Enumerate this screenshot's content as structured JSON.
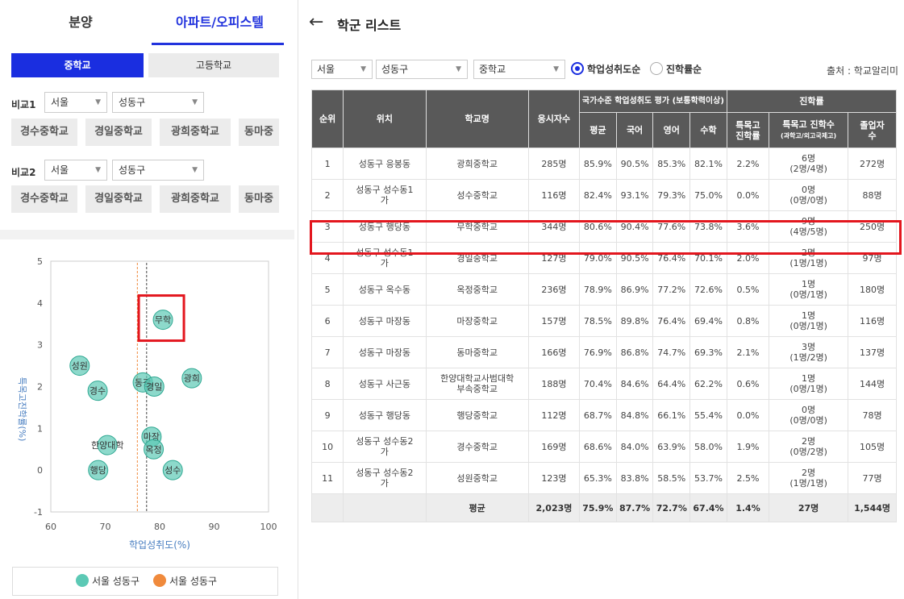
{
  "tabs": {
    "presale": "분양",
    "apt": "아파트/오피스텔"
  },
  "level_buttons": {
    "middle": "중학교",
    "high": "고등학교"
  },
  "compare1": {
    "label": "비교1",
    "city": "서울",
    "district": "성동구",
    "chips": [
      "경수중학교",
      "경일중학교",
      "광희중학교",
      "동마중"
    ]
  },
  "compare2": {
    "label": "비교2",
    "city": "서울",
    "district": "성동구",
    "chips": [
      "경수중학교",
      "경일중학교",
      "광희중학교",
      "동마중"
    ]
  },
  "legend": {
    "item1": "서울 성동구",
    "item2": "서울 성동구",
    "color1": "#5cc9b5",
    "color2": "#f08a3c"
  },
  "chart_data": {
    "type": "scatter",
    "xlabel": "학업성취도(%)",
    "ylabel": "특목고진학률(%)",
    "xlim": [
      60,
      100
    ],
    "ylim": [
      -1,
      5
    ],
    "xticks": [
      "60",
      "70",
      "80",
      "90",
      "100"
    ],
    "yticks": [
      "5",
      "4",
      "3",
      "2",
      "1",
      "0",
      "-1"
    ],
    "grid": false,
    "vlines": [
      {
        "x": 75.9,
        "color": "#f08a3c"
      },
      {
        "x": 77.6,
        "color": "#444444"
      }
    ],
    "points": [
      {
        "label": "성원",
        "x": 65.3,
        "y": 2.5
      },
      {
        "label": "경수",
        "x": 68.6,
        "y": 1.9
      },
      {
        "label": "동광",
        "x": 76.9,
        "y": 2.1
      },
      {
        "label": "경일",
        "x": 79.0,
        "y": 2.0
      },
      {
        "label": "광희",
        "x": 85.9,
        "y": 2.2
      },
      {
        "label": "무학",
        "x": 80.6,
        "y": 3.6
      },
      {
        "label": "한양대학",
        "x": 70.4,
        "y": 0.6
      },
      {
        "label": "행당",
        "x": 68.7,
        "y": 0.0
      },
      {
        "label": "마장",
        "x": 78.5,
        "y": 0.8
      },
      {
        "label": "옥정",
        "x": 78.9,
        "y": 0.5
      },
      {
        "label": "성수",
        "x": 82.4,
        "y": 0.0
      }
    ]
  },
  "list": {
    "title": "학군 리스트",
    "filters": {
      "city": "서울",
      "district": "성동구",
      "level": "중학교"
    },
    "sort_options": [
      "학업성취도순",
      "진학률순"
    ],
    "source": "출처 : 학교알리미",
    "headers": {
      "rank": "순위",
      "location": "위치",
      "school": "학교명",
      "examinees": "응시자수",
      "national": "국가수준 학업성취도 평가 (보통학력이상)",
      "avg": "평균",
      "korean": "국어",
      "english": "영어",
      "math": "수학",
      "advancement": "진학률",
      "special_rate_1": "특목고",
      "special_rate_2": "진학률",
      "special_count": "특목고 진학수",
      "special_count_sub": "(과학고/외고국제고)",
      "graduates_1": "졸업자",
      "graduates_2": "수"
    },
    "rows": [
      {
        "rank": "1",
        "loc1": "성동구 응봉동",
        "loc2": "",
        "school1": "광희중학교",
        "school2": "",
        "examinees": "285명",
        "avg": "85.9%",
        "korean": "90.5%",
        "english": "85.3%",
        "math": "82.1%",
        "rate": "2.2%",
        "count": "6명",
        "count_sub": "(2명/4명)",
        "grads": "272명"
      },
      {
        "rank": "2",
        "loc1": "성동구 성수동1",
        "loc2": "가",
        "school1": "성수중학교",
        "school2": "",
        "examinees": "116명",
        "avg": "82.4%",
        "korean": "93.1%",
        "english": "79.3%",
        "math": "75.0%",
        "rate": "0.0%",
        "count": "0명",
        "count_sub": "(0명/0명)",
        "grads": "88명"
      },
      {
        "rank": "3",
        "loc1": "성동구 행당동",
        "loc2": "",
        "school1": "무학중학교",
        "school2": "",
        "examinees": "344명",
        "avg": "80.6%",
        "korean": "90.4%",
        "english": "77.6%",
        "math": "73.8%",
        "rate": "3.6%",
        "count": "9명",
        "count_sub": "(4명/5명)",
        "grads": "250명"
      },
      {
        "rank": "4",
        "loc1": "성동구 성수동1",
        "loc2": "가",
        "school1": "경일중학교",
        "school2": "",
        "examinees": "127명",
        "avg": "79.0%",
        "korean": "90.5%",
        "english": "76.4%",
        "math": "70.1%",
        "rate": "2.0%",
        "count": "2명",
        "count_sub": "(1명/1명)",
        "grads": "97명"
      },
      {
        "rank": "5",
        "loc1": "성동구 옥수동",
        "loc2": "",
        "school1": "옥정중학교",
        "school2": "",
        "examinees": "236명",
        "avg": "78.9%",
        "korean": "86.9%",
        "english": "77.2%",
        "math": "72.6%",
        "rate": "0.5%",
        "count": "1명",
        "count_sub": "(0명/1명)",
        "grads": "180명"
      },
      {
        "rank": "6",
        "loc1": "성동구 마장동",
        "loc2": "",
        "school1": "마장중학교",
        "school2": "",
        "examinees": "157명",
        "avg": "78.5%",
        "korean": "89.8%",
        "english": "76.4%",
        "math": "69.4%",
        "rate": "0.8%",
        "count": "1명",
        "count_sub": "(0명/1명)",
        "grads": "116명"
      },
      {
        "rank": "7",
        "loc1": "성동구 마장동",
        "loc2": "",
        "school1": "동마중학교",
        "school2": "",
        "examinees": "166명",
        "avg": "76.9%",
        "korean": "86.8%",
        "english": "74.7%",
        "math": "69.3%",
        "rate": "2.1%",
        "count": "3명",
        "count_sub": "(1명/2명)",
        "grads": "137명"
      },
      {
        "rank": "8",
        "loc1": "성동구 사근동",
        "loc2": "",
        "school1": "한양대학교사범대학",
        "school2": "부속중학교",
        "examinees": "188명",
        "avg": "70.4%",
        "korean": "84.6%",
        "english": "64.4%",
        "math": "62.2%",
        "rate": "0.6%",
        "count": "1명",
        "count_sub": "(0명/1명)",
        "grads": "144명"
      },
      {
        "rank": "9",
        "loc1": "성동구 행당동",
        "loc2": "",
        "school1": "행당중학교",
        "school2": "",
        "examinees": "112명",
        "avg": "68.7%",
        "korean": "84.8%",
        "english": "66.1%",
        "math": "55.4%",
        "rate": "0.0%",
        "count": "0명",
        "count_sub": "(0명/0명)",
        "grads": "78명"
      },
      {
        "rank": "10",
        "loc1": "성동구 성수동2",
        "loc2": "가",
        "school1": "경수중학교",
        "school2": "",
        "examinees": "169명",
        "avg": "68.6%",
        "korean": "84.0%",
        "english": "63.9%",
        "math": "58.0%",
        "rate": "1.9%",
        "count": "2명",
        "count_sub": "(0명/2명)",
        "grads": "105명"
      },
      {
        "rank": "11",
        "loc1": "성동구 성수동2",
        "loc2": "가",
        "school1": "성원중학교",
        "school2": "",
        "examinees": "123명",
        "avg": "65.3%",
        "korean": "83.8%",
        "english": "58.5%",
        "math": "53.7%",
        "rate": "2.5%",
        "count": "2명",
        "count_sub": "(1명/1명)",
        "grads": "77명"
      }
    ],
    "average_row": {
      "label": "평균",
      "examinees": "2,023명",
      "avg": "75.9%",
      "korean": "87.7%",
      "english": "72.7%",
      "math": "67.4%",
      "rate": "1.4%",
      "count": "27명",
      "grads": "1,544명"
    }
  }
}
